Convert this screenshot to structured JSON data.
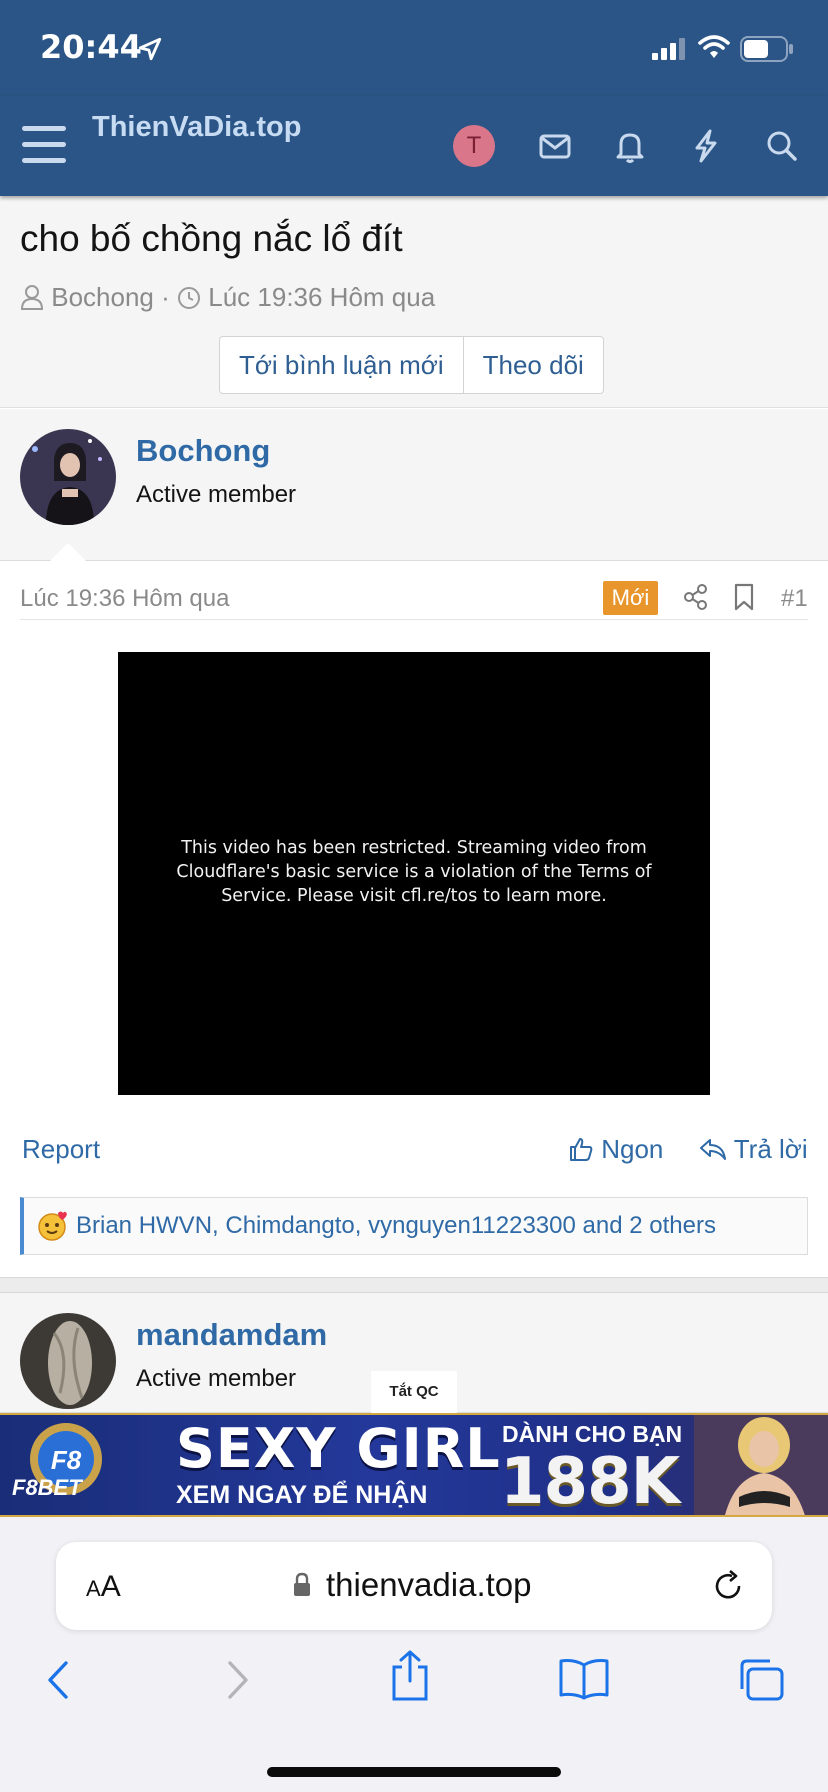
{
  "status": {
    "time": "20:44"
  },
  "site": {
    "title": "ThienVaDia.top",
    "user_initial": "T"
  },
  "thread": {
    "title": "cho bố chồng nắc lổ đít",
    "author": "Bochong",
    "time": "Lúc 19:36 Hôm qua",
    "buttons": [
      "Tới bình luận mới",
      "Theo dõi"
    ]
  },
  "post": {
    "author": "Bochong",
    "role": "Active member",
    "date": "Lúc 19:36 Hôm qua",
    "badge": "Mới",
    "number": "#1",
    "video_message": "This video has been restricted. Streaming video from Cloudflare's basic service is a violation of the Terms of Service. Please visit cfl.re/tos to learn more.",
    "report": "Report",
    "like": "Ngon",
    "reply": "Trả lời",
    "reactions": "Brian HWVN, Chimdangto, vynguyen11223300 and 2 others"
  },
  "next_post": {
    "author": "mandamdam",
    "role": "Active member"
  },
  "ad": {
    "label": "Tắt QC",
    "brand": "F8BET",
    "headline": "SEXY GIRL",
    "subline": "XEM NGAY ĐỂ NHẬN",
    "for_you": "DÀNH CHO BẠN",
    "amount": "188K"
  },
  "browser": {
    "aa_small": "A",
    "aa_large": "A",
    "url": "thienvadia.top"
  },
  "colors": {
    "header": "#2b5586",
    "link": "#2f6aa6",
    "badge": "#e8962b"
  }
}
